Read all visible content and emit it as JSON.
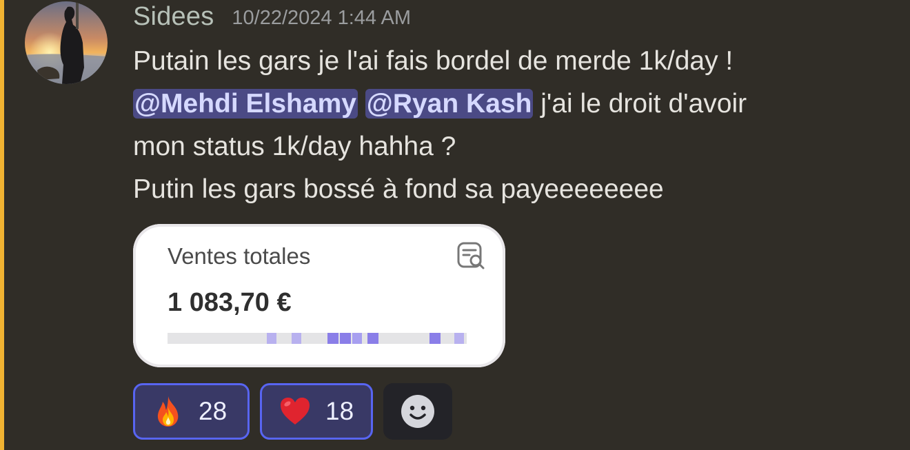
{
  "theme": {
    "accent_bar": "#f0b232",
    "mention_bg": "#4b4a85",
    "reaction_border": "#5865f2",
    "reaction_bg": "#393966"
  },
  "message": {
    "author": "Sidees",
    "timestamp": "10/22/2024 1:44 AM",
    "avatar": "sunset-silhouette-avatar",
    "lines": [
      "Putain les gars je l'ai fais bordel de merde 1k/day !",
      "j'ai le droit d'avoir",
      "mon status 1k/day hahha ?",
      "Putin les gars bossé à fond sa payeeeeeeee"
    ],
    "mentions": [
      "@Mehdi Elshamy",
      "@Ryan Kash"
    ]
  },
  "embed": {
    "title": "Ventes totales",
    "value": "1 083,70 €",
    "icon": "report-search-icon"
  },
  "reactions": [
    {
      "emoji": "fire-emoji",
      "count": "28"
    },
    {
      "emoji": "heart-emoji",
      "count": "18"
    }
  ],
  "add_reaction_icon": "smiley-icon"
}
